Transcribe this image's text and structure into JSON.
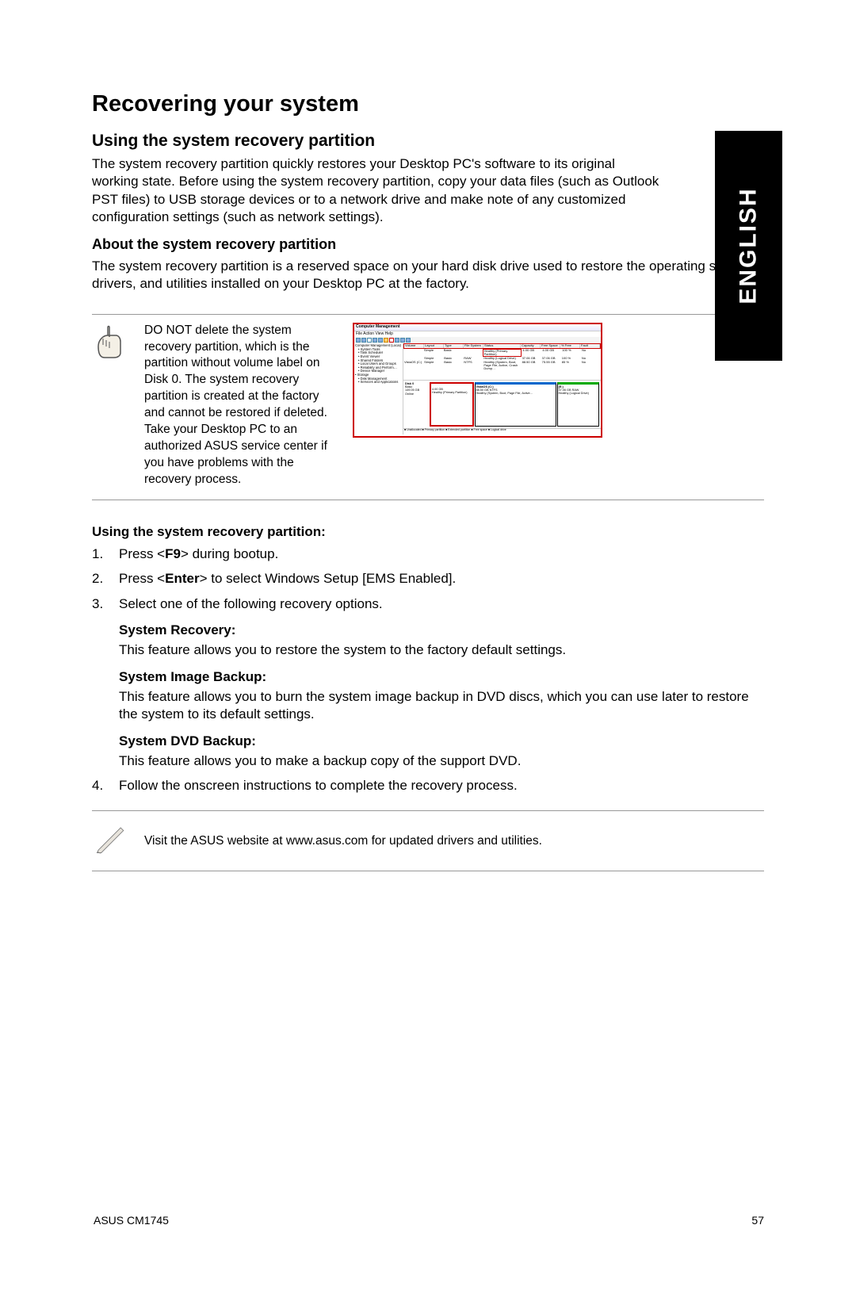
{
  "sideTab": "ENGLISH",
  "h1": "Recovering your system",
  "h2": "Using the system recovery partition",
  "intro": "The system recovery partition quickly restores your Desktop PC's software to its original working state. Before using the system recovery partition, copy your data files (such as Outlook PST files) to USB storage devices or to a network drive and make note of any customized configuration settings (such as network settings).",
  "h3": "About the system recovery partition",
  "aboutP": "The system recovery partition is a reserved space on your hard disk drive used to restore the operating system, drivers, and utilities installed on your Desktop PC at the factory.",
  "note1": "DO NOT delete the system recovery partition, which is the partition without volume label on Disk 0. The system recovery partition is created at the factory and cannot be restored if deleted. Take your Desktop PC to an authorized ASUS service center if you have problems with the recovery process.",
  "screenshot": {
    "title": "Computer Management",
    "menu": "File   Action   View   Help",
    "tree": [
      "Computer Management (Local)",
      "System Tools",
      "Task Scheduler",
      "Event Viewer",
      "Shared Folders",
      "Local Users and Groups",
      "Reliability and Perform…",
      "Device Manager",
      "Storage",
      "Disk Management",
      "Services and Applications"
    ],
    "cols": [
      "Volume",
      "Layout",
      "Type",
      "File System",
      "Status",
      "Capacity",
      "Free Space",
      "% Free",
      "Fault"
    ],
    "rows": [
      {
        "vol": "",
        "layout": "Simple",
        "type": "Basic",
        "fs": "",
        "status": "Healthy (Primary Partition)",
        "cap": "4.00 GB",
        "free": "4.00 GB",
        "pct": "100 %",
        "fault": "No",
        "red": true
      },
      {
        "vol": "",
        "layout": "Simple",
        "type": "Basic",
        "fs": "RAW",
        "status": "Healthy (Logical Drive)",
        "cap": "37.06 GB",
        "free": "37.06 GB",
        "pct": "100 %",
        "fault": "No"
      },
      {
        "vol": "VistaOS (C:)",
        "layout": "Simple",
        "type": "Basic",
        "fs": "NTFS",
        "status": "Healthy (System, Boot, Page File, Active, Crash Dump…",
        "cap": "88.50 GB",
        "free": "75.55 GB",
        "pct": "85 %",
        "fault": "No"
      }
    ],
    "disk": {
      "label": "Disk 0",
      "sub": "Basic",
      "size": "149.05 GB",
      "state": "Online"
    },
    "parts": [
      {
        "name": "",
        "size": "4.00 GB",
        "status": "Healthy (Primary Partition)",
        "red": true
      },
      {
        "name": "VistaOS (C:)",
        "size": "88.50 GB NTFS",
        "status": "Healthy (System, Boot, Page File, Active…"
      },
      {
        "name": "(E:)",
        "size": "37.06 GB RAW",
        "status": "Healthy (Logical Drive)"
      }
    ],
    "legend": "■ Unallocated ■ Primary partition ■ Extended partition ■ Free space ■ Logical drive"
  },
  "stepsHead": "Using the system recovery partition:",
  "steps": [
    {
      "n": "1.",
      "t": "Press <F9> during bootup.",
      "bold": [
        "F9"
      ]
    },
    {
      "n": "2.",
      "t": "Press <Enter> to select Windows Setup [EMS Enabled].",
      "bold": [
        "Enter"
      ]
    },
    {
      "n": "3.",
      "t": "Select one of the following recovery options."
    }
  ],
  "options": [
    {
      "h": "System Recovery:",
      "p": "This feature allows you to restore the system to the factory default settings."
    },
    {
      "h": "System Image Backup:",
      "p": "This feature allows you to burn the system image backup in DVD discs, which you can use later to restore the system to its default settings."
    },
    {
      "h": "System DVD Backup:",
      "p": "This feature allows you to make a backup copy of the support DVD."
    }
  ],
  "step4": {
    "n": "4.",
    "t": "Follow the onscreen instructions to complete the recovery process."
  },
  "note2": "Visit the ASUS website at www.asus.com for updated drivers and utilities.",
  "footer": {
    "left": "ASUS CM1745",
    "right": "57"
  }
}
